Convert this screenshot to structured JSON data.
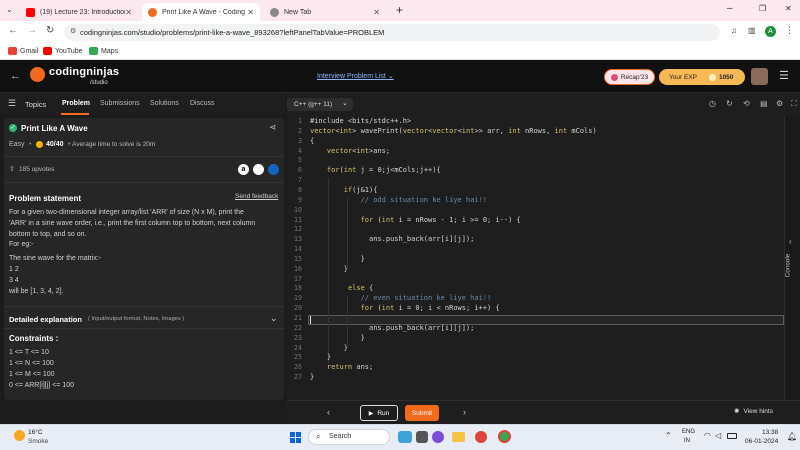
{
  "browser": {
    "tabs": [
      {
        "label": "(19) Lecture 23: Introduction t",
        "active": false
      },
      {
        "label": "Print Like A Wave - Coding Nin",
        "active": true
      },
      {
        "label": "New Tab",
        "active": false
      }
    ],
    "url": "codingninjas.com/studio/problems/print-like-a-wave_893268?leftPanelTabValue=PROBLEM",
    "profile_initial": "A",
    "bookmarks": [
      "Gmail",
      "YouTube",
      "Maps"
    ]
  },
  "header": {
    "logo_main": "codingninjas",
    "logo_sub": "/studio",
    "center_link": "Interview Problem List",
    "recap_label": "Recap'23",
    "exp_label": "Your EXP",
    "exp_value": "1050"
  },
  "subheader": {
    "topics": "Topics",
    "tabs": [
      "Problem",
      "Submissions",
      "Solutions",
      "Discuss"
    ],
    "language": "C++ (g++ 11)"
  },
  "problem": {
    "title": "Print Like A Wave",
    "difficulty": "Easy",
    "score": "40/40",
    "avg_time": "Average time to solve is 20m",
    "upvotes": "185 upvotes",
    "statement_heading": "Problem statement",
    "send_feedback": "Send feedback",
    "statement_lines": [
      "For a given two-dimensional integer array/list 'ARR' of size (N x M), print the",
      "'ARR' in a sine wave order, i.e., print the first column top to bottom, next column",
      "bottom to top, and so on."
    ],
    "eg_label": "For eg:-",
    "sine_intro": "The sine wave for the matrix:-",
    "matrix_rows": [
      "1 2",
      "3 4"
    ],
    "result_line": "will be [1, 3, 4, 2].",
    "detailed_heading": "Detailed explanation",
    "detailed_hint": "( Input/output format, Notes, Images )",
    "constraints_heading": "Constraints :",
    "constraints": [
      "1 <= T <= 10",
      "1 <= N <= 100",
      "1 <= M <= 100",
      "0 <= ARR[i][j] <= 100"
    ]
  },
  "editor": {
    "lines": [
      "#include <bits/stdc++.h>",
      "vector<int> wavePrint(vector<vector<int>> arr, int nRows, int mCols)",
      "{",
      "    vector<int>ans;",
      "",
      "    for(int j = 0;j<mCols;j++){",
      "",
      "        if(j&1){",
      "            // odd situation ke liye hai!!",
      "",
      "            for (int i = nRows - 1; i >= 0; i--) {",
      "",
      "              ans.push_back(arr[i][j]);",
      "",
      "            }",
      "        }",
      "",
      "         else {",
      "            // even situation ke liye hai!!",
      "            for (int i = 0; i < nRows; i++) {",
      "",
      "              ans.push_back(arr[i][j]);",
      "            }",
      "        }",
      "    }",
      "    return ans;",
      "}"
    ],
    "console_label": "Console"
  },
  "actions": {
    "run": "Run",
    "submit": "Submit",
    "view_hints": "View hints"
  },
  "taskbar": {
    "temperature": "16°C",
    "weather": "Smoke",
    "search": "Search",
    "lang_top": "ENG",
    "lang_bottom": "IN",
    "time": "13:38",
    "date": "06-01-2024"
  },
  "colors": {
    "accent_orange": "#f26b1d",
    "easy_green": "#2bb673",
    "header_bg": "#111111",
    "panel_bg": "#262626",
    "editor_bg": "#1e1e1e",
    "keyword": "#d4c06a",
    "comment": "#6a8aa8"
  }
}
